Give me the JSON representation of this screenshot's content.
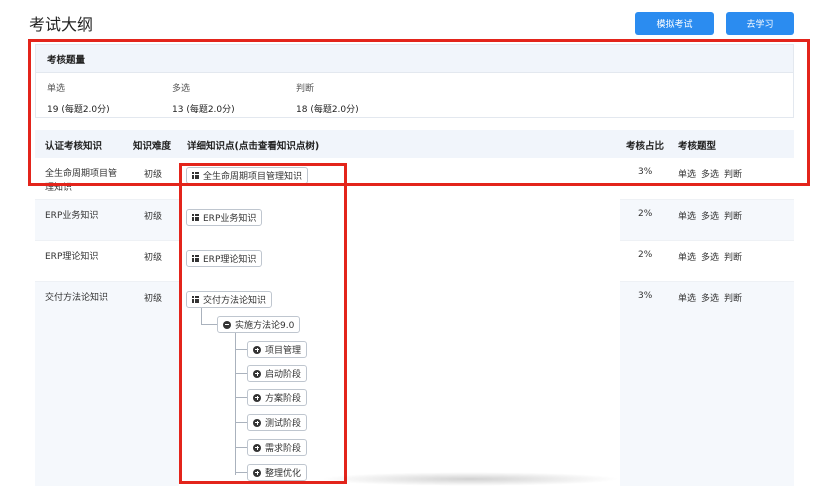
{
  "page": {
    "title": "考试大纲"
  },
  "buttons": {
    "mock_exam": "模拟考试",
    "go_study": "去学习"
  },
  "exam": {
    "header": "考核题量",
    "types": [
      {
        "label": "单选",
        "value": "19 (每题2.0分)"
      },
      {
        "label": "多选",
        "value": "13 (每题2.0分)"
      },
      {
        "label": "判断",
        "value": "18 (每题2.0分)"
      }
    ]
  },
  "table": {
    "headers": {
      "knowledge": "认证考核知识",
      "difficulty": "知识难度",
      "detail": "详细知识点(点击查看知识点树)",
      "ratio": "考核占比",
      "question_types": "考核题型"
    },
    "rows": [
      {
        "name": "全生命周期项目管理知识",
        "level": "初级",
        "node": "全生命周期项目管理知识",
        "ratio": "3%",
        "types": [
          "单选",
          "多选",
          "判断"
        ]
      },
      {
        "name": "ERP业务知识",
        "level": "初级",
        "node": "ERP业务知识",
        "ratio": "2%",
        "types": [
          "单选",
          "多选",
          "判断"
        ]
      },
      {
        "name": "ERP理论知识",
        "level": "初级",
        "node": "ERP理论知识",
        "ratio": "2%",
        "types": [
          "单选",
          "多选",
          "判断"
        ]
      },
      {
        "name": "交付方法论知识",
        "level": "初级",
        "node": "交付方法论知识",
        "ratio": "3%",
        "types": [
          "单选",
          "多选",
          "判断"
        ]
      }
    ]
  },
  "tree": {
    "child": "实施方法论9.0",
    "leaves": [
      "项目管理",
      "启动阶段",
      "方案阶段",
      "测试阶段",
      "需求阶段",
      "整理优化"
    ]
  },
  "icons": {
    "grid": "grid-icon",
    "collapse": "minus-circle-icon",
    "expand": "plus-circle-icon"
  },
  "colors": {
    "primary": "#2b8cf0",
    "highlight_border": "#e3241b",
    "header_bg": "#f1f5fb"
  }
}
